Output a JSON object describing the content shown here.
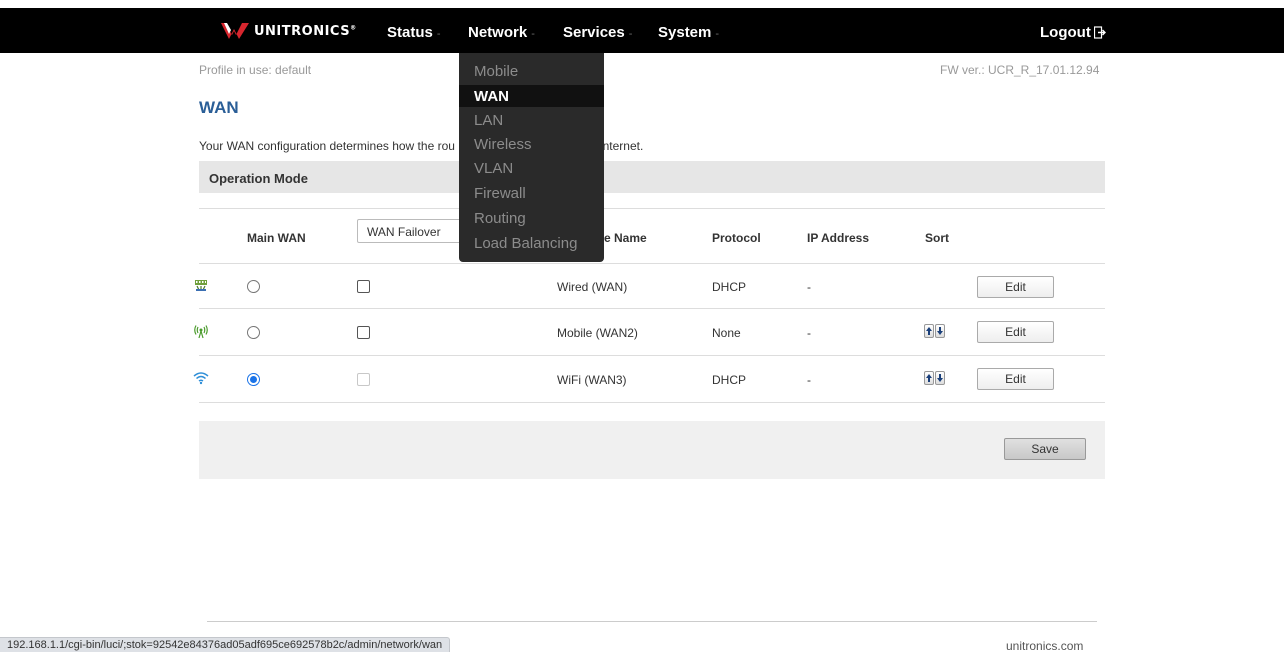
{
  "brand": {
    "name": "UNITRONICS",
    "reg_mark": "®",
    "logo_color": "#d7262e"
  },
  "nav": {
    "items": [
      {
        "label": "Status"
      },
      {
        "label": "Network"
      },
      {
        "label": "Services"
      },
      {
        "label": "System"
      }
    ],
    "caret": "-",
    "logout": "Logout"
  },
  "dropdown": {
    "items": [
      {
        "label": "Mobile",
        "active": false
      },
      {
        "label": "WAN",
        "active": true
      },
      {
        "label": "LAN",
        "active": false
      },
      {
        "label": "Wireless",
        "active": false
      },
      {
        "label": "VLAN",
        "active": false
      },
      {
        "label": "Firewall",
        "active": false
      },
      {
        "label": "Routing",
        "active": false
      },
      {
        "label": "Load Balancing",
        "active": false
      }
    ]
  },
  "info": {
    "profile": "Profile in use: default",
    "fw_version": "FW ver.: UCR_R_17.01.12.94"
  },
  "page": {
    "title": "WAN",
    "description_start": "Your WAN configuration determines how the rou",
    "description_end": "e internet."
  },
  "section": {
    "title": "Operation Mode"
  },
  "table": {
    "headers": {
      "main_wan": "Main WAN",
      "mode_select": "WAN Failover",
      "interface_name": "e Name",
      "protocol": "Protocol",
      "ip_address": "IP Address",
      "sort": "Sort"
    },
    "rows": [
      {
        "icon": "wired-icon",
        "interface": "Wired (WAN)",
        "protocol": "DHCP",
        "ip": "-",
        "main_selected": false,
        "backup_checked": false,
        "backup_disabled": false,
        "has_sort": false,
        "edit_label": "Edit"
      },
      {
        "icon": "mobile-signal-icon",
        "interface": "Mobile (WAN2)",
        "protocol": "None",
        "ip": "-",
        "main_selected": false,
        "backup_checked": false,
        "backup_disabled": false,
        "has_sort": true,
        "edit_label": "Edit"
      },
      {
        "icon": "wifi-icon",
        "interface": "WiFi (WAN3)",
        "protocol": "DHCP",
        "ip": "-",
        "main_selected": true,
        "backup_checked": false,
        "backup_disabled": true,
        "has_sort": true,
        "edit_label": "Edit"
      }
    ]
  },
  "actions": {
    "save_label": "Save"
  },
  "footer": {
    "site": "unitronics.com",
    "status_url": "192.168.1.1/cgi-bin/luci/;stok=92542e84376ad05adf695ce692578b2c/admin/network/wan"
  },
  "colors": {
    "title_blue": "#2a5e97",
    "radio_blue": "#1a73e8",
    "topbar": "#000000",
    "dropdown_bg": "#2a2a2a"
  }
}
